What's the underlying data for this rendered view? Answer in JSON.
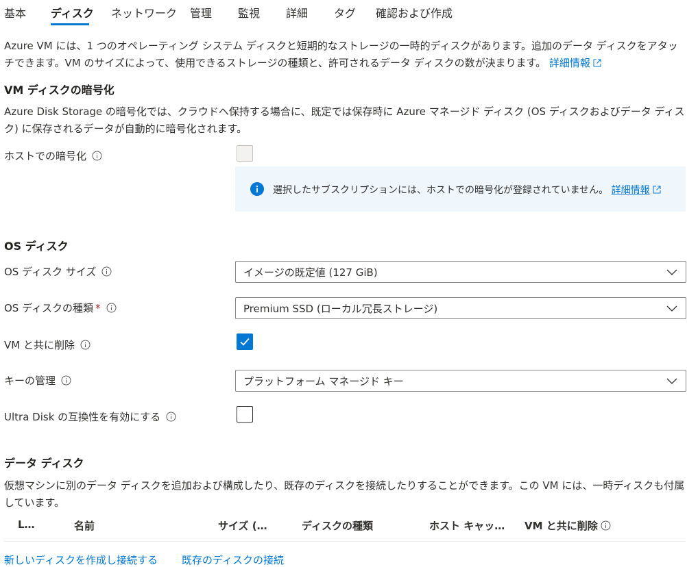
{
  "tabs": [
    {
      "label": "基本"
    },
    {
      "label": "ディスク"
    },
    {
      "label": "ネットワーク"
    },
    {
      "label": "管理"
    },
    {
      "label": "監視"
    },
    {
      "label": "詳細"
    },
    {
      "label": "タグ"
    },
    {
      "label": "確認および作成"
    }
  ],
  "active_tab": "ディスク",
  "intro": {
    "text": "Azure VM には、1 つのオペレーティング システム ディスクと短期的なストレージの一時的ディスクがあります。追加のデータ ディスクをアタッチできます。VM のサイズによって、使用できるストレージの種類と、許可されるデータ ディスクの数が決まります。",
    "link": "詳細情報"
  },
  "encryption": {
    "heading": "VM ディスクの暗号化",
    "description": "Azure Disk Storage の暗号化では、クラウドへ保持する場合に、既定では保存時に Azure マネージド ディスク (OS ディスクおよびデータ ディスク) に保存されるデータが自動的に暗号化されます。",
    "host_label": "ホストでの暗号化",
    "host_checked": false,
    "host_disabled": true,
    "info_text": "選択したサブスクリプションには、ホストでの暗号化が登録されていません。",
    "info_link": "詳細情報"
  },
  "os_disk": {
    "heading": "OS ディスク",
    "size_label": "OS ディスク サイズ",
    "size_value": "イメージの既定値 (127 GiB)",
    "type_label": "OS ディスクの種類",
    "required_mark": "*",
    "type_value": "Premium SSD (ローカル冗長ストレージ)",
    "delete_label": "VM と共に削除",
    "delete_checked": true,
    "key_label": "キーの管理",
    "key_value": "プラットフォーム マネージド キー",
    "ultra_label": "Ultra Disk の互換性を有効にする",
    "ultra_checked": false
  },
  "data_disks": {
    "heading": "データ ディスク",
    "description": "仮想マシンに別のデータ ディスクを追加および構成したり、既存のディスクを接続したりすることができます。この VM には、一時ディスクも付属しています。",
    "columns": [
      "L…",
      "名前",
      "サイズ (…",
      "ディスクの種類",
      "ホスト キャッ…",
      "VM と共に削除"
    ],
    "create_link": "新しいディスクを作成し接続する",
    "attach_link": "既存のディスクの接続"
  },
  "colors": {
    "accent": "#0078d4",
    "info_bg": "#eff6fc",
    "text": "#323130",
    "required": "#a4262c"
  },
  "icons": [
    "info-icon",
    "external-link-icon",
    "chevron-down-icon",
    "checkmark-icon",
    "info-filled-icon"
  ]
}
